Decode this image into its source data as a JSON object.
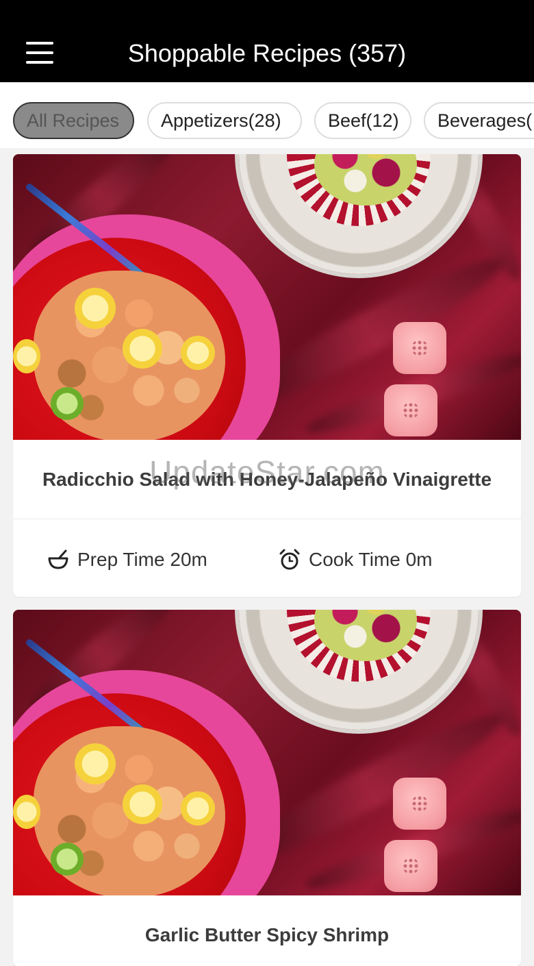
{
  "header": {
    "title": "Shoppable Recipes (357)",
    "menu_icon": "hamburger-menu-icon"
  },
  "filters": [
    {
      "label": "All Recipes",
      "active": true
    },
    {
      "label": "Appetizers(28)",
      "active": false
    },
    {
      "label": "Beef(12)",
      "active": false
    },
    {
      "label": "Beverages(",
      "active": false
    }
  ],
  "recipes": [
    {
      "title": "Radicchio Salad with Honey-Jalapeño Vinaigrette",
      "prep_label": "Prep Time 20m",
      "cook_label": "Cook Time 0m",
      "prep_icon": "mortar-bowl-icon",
      "cook_icon": "alarm-clock-icon"
    },
    {
      "title": "Garlic Butter Spicy Shrimp"
    }
  ],
  "watermark": "UpdateStar.com",
  "colors": {
    "header_bg": "#000000",
    "chip_active_bg": "#8a8a8a",
    "page_bg": "#f2f2f2"
  }
}
